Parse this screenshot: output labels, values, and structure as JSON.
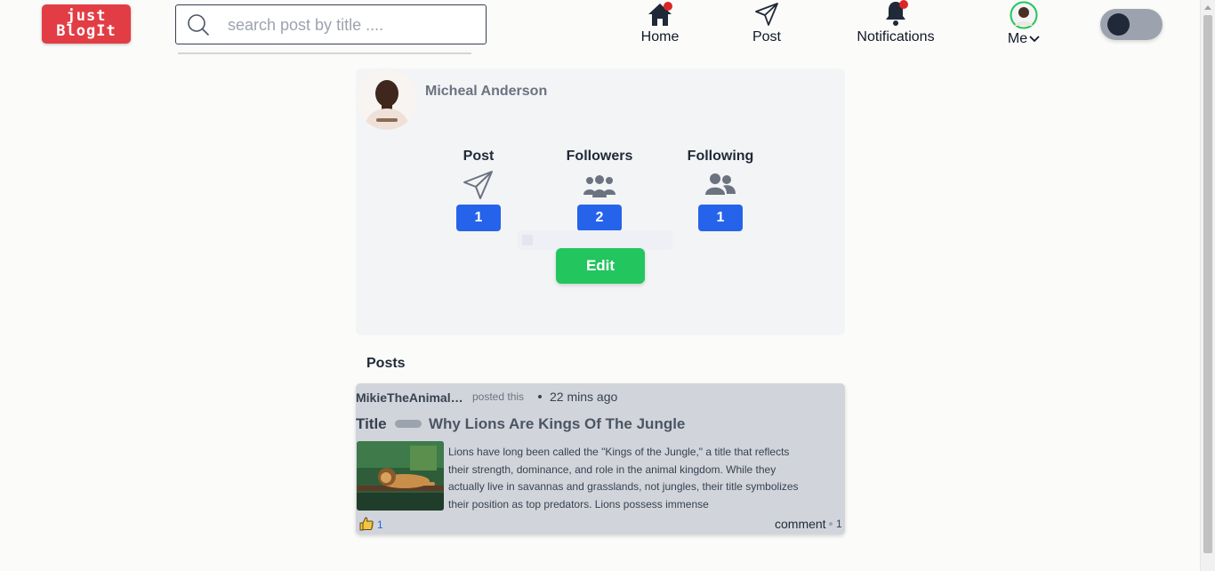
{
  "header": {
    "logo_line1": "just",
    "logo_line2": "BlogIt",
    "search_placeholder": "search post by title ....",
    "nav": {
      "home": "Home",
      "post": "Post",
      "notifications": "Notifications",
      "me": "Me"
    }
  },
  "profile": {
    "name": "Micheal Anderson",
    "stats": [
      {
        "label": "Post",
        "count": "1",
        "icon": "paper-plane-icon"
      },
      {
        "label": "Followers",
        "count": "2",
        "icon": "people-group-icon"
      },
      {
        "label": "Following",
        "count": "1",
        "icon": "user-group-icon"
      }
    ],
    "edit_label": "Edit"
  },
  "posts_heading": "Posts",
  "post": {
    "author": "MikieTheAnimalLover",
    "posted_this": "posted this",
    "time": "22 mins ago",
    "title_label": "Title",
    "title": "Why Lions Are Kings Of The Jungle",
    "excerpt": "Lions have long been called the \"Kings of the Jungle,\" a title that reflects their strength, dominance, and role in the animal kingdom. While they actually live in savannas and grasslands, not jungles, their title symbolizes their position as top predators. Lions possess immense",
    "likes": "1",
    "comment_label": "comment",
    "comments": "1"
  },
  "colors": {
    "logo": "#e23d45",
    "accent_blue": "#2563eb",
    "edit_green": "#22c55e",
    "notification_dot": "#dc2626"
  }
}
